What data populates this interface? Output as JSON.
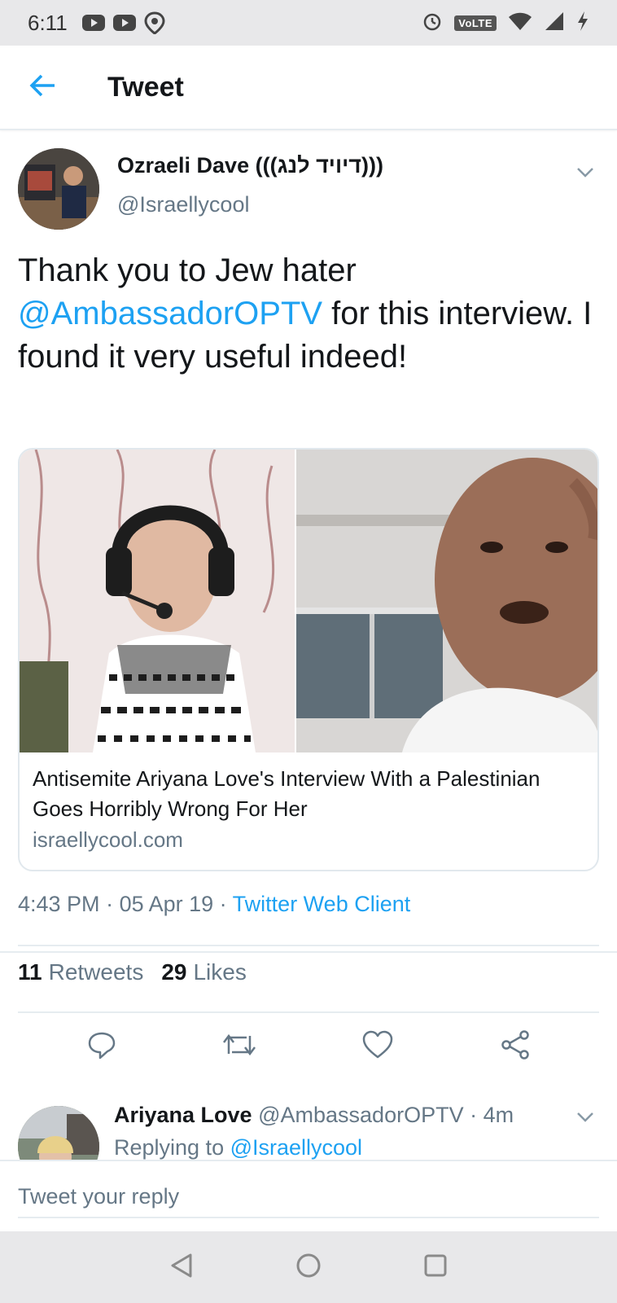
{
  "status_bar": {
    "time": "6:11",
    "network_badge": "VoLTE",
    "icons": [
      "youtube-icon",
      "youtube-icon",
      "location-icon",
      "alarm-icon",
      "volte-icon",
      "wifi-icon",
      "signal-icon",
      "charging-icon"
    ]
  },
  "header": {
    "title": "Tweet",
    "back_icon": "arrow-left-icon"
  },
  "tweet": {
    "author_name": "Ozraeli Dave (((דיויד לנג)))",
    "author_handle": "@Israellycool",
    "text_before_mention": "Thank you  to Jew hater ",
    "mention": "@AmbassadorOPTV",
    "text_after_mention": " for this interview. I found it very useful indeed!",
    "card": {
      "title": "Antisemite Ariyana Love's Interview With a Palestinian Goes Horribly Wrong For Her",
      "domain": "israellycool.com"
    },
    "time": "4:43 PM",
    "date": "05 Apr 19",
    "separator": " · ",
    "source": "Twitter Web Client",
    "retweets_count": "11",
    "retweets_label": "Retweets",
    "likes_count": "29",
    "likes_label": "Likes",
    "actions": [
      "reply-icon",
      "retweet-icon",
      "like-icon",
      "share-icon"
    ]
  },
  "reply": {
    "name": "Ariyana Love",
    "handle": "@AmbassadorOPTV",
    "time": "4m",
    "separator": " · ",
    "replying_to_label": "Replying to ",
    "replying_to_handle": "@Israellycool"
  },
  "composer": {
    "placeholder": "Tweet your reply"
  },
  "colors": {
    "accent": "#1da1f2",
    "secondary_text": "#657786",
    "primary_text": "#14171a"
  }
}
